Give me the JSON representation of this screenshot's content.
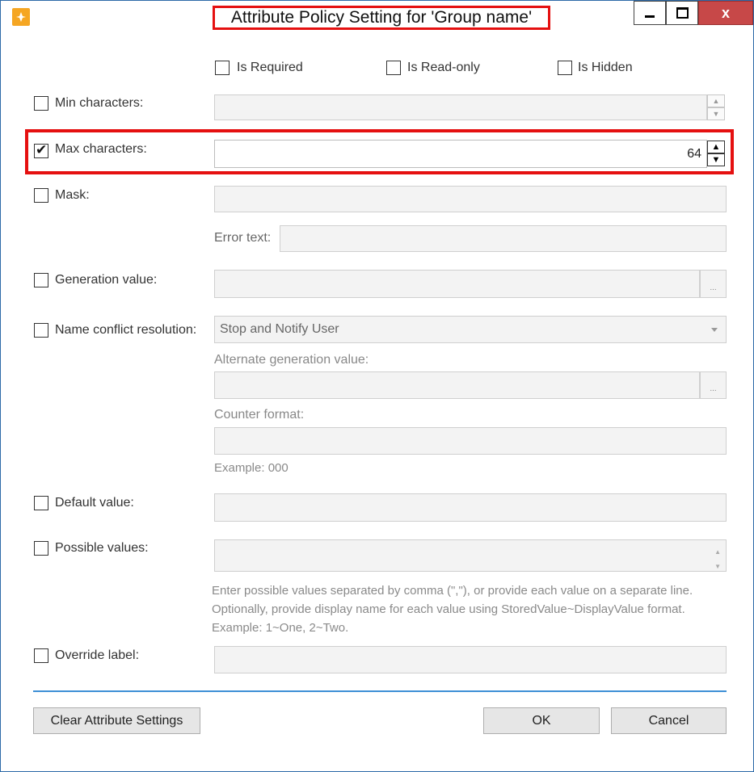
{
  "window": {
    "title": "Attribute Policy Setting for 'Group name'",
    "close_glyph": "x"
  },
  "flags": {
    "is_required": "Is Required",
    "is_read_only": "Is Read-only",
    "is_hidden": "Is Hidden"
  },
  "fields": {
    "min_characters": {
      "label": "Min characters:",
      "checked": false,
      "value": ""
    },
    "max_characters": {
      "label": "Max characters:",
      "checked": true,
      "value": "64"
    },
    "mask": {
      "label": "Mask:",
      "checked": false,
      "value": "",
      "error_text_label": "Error text:"
    },
    "generation_value": {
      "label": "Generation value:",
      "checked": false,
      "value": "",
      "button": "..."
    },
    "name_conflict_resolution": {
      "label": "Name conflict resolution:",
      "checked": false,
      "selected": "Stop and Notify User",
      "alternate_label": "Alternate generation value:",
      "alternate_button": "...",
      "counter_label": "Counter format:",
      "counter_example": "Example: 000"
    },
    "default_value": {
      "label": "Default value:",
      "checked": false,
      "value": ""
    },
    "possible_values": {
      "label": "Possible values:",
      "checked": false,
      "value": "",
      "help": "Enter possible values separated by comma (\",\"), or provide each value on a separate line. Optionally, provide display name for each value using StoredValue~DisplayValue format. Example: 1~One, 2~Two."
    },
    "override_label": {
      "label": "Override label:",
      "checked": false,
      "value": ""
    }
  },
  "buttons": {
    "clear": "Clear Attribute Settings",
    "ok": "OK",
    "cancel": "Cancel"
  },
  "colors": {
    "highlight": "#e51010",
    "divider": "#3d8fd6",
    "close_button": "#c74848"
  }
}
